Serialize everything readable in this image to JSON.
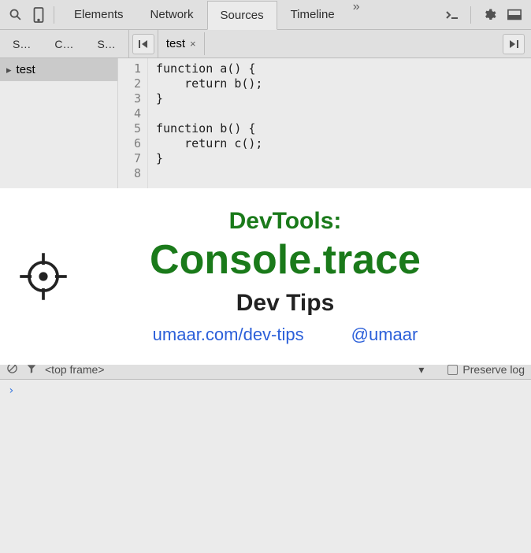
{
  "toolbar": {
    "tabs": [
      "Elements",
      "Network",
      "Sources",
      "Timeline"
    ],
    "active_tab_index": 2,
    "overflow": "»"
  },
  "subtoolbar": {
    "minitabs": [
      "S…",
      "C…",
      "S…"
    ],
    "file_tab": "test",
    "close": "×"
  },
  "sidebar": {
    "tree_item": "test",
    "expand": "▸"
  },
  "editor": {
    "lines": [
      "function a() {",
      "    return b();",
      "}",
      "",
      "function b() {",
      "    return c();",
      "}",
      ""
    ]
  },
  "consolebar": {
    "frame": "<top frame>",
    "dropdown": "▾",
    "preserve": "Preserve log"
  },
  "console": {
    "prompt": "›"
  },
  "banner": {
    "line1": "DevTools:",
    "line2": "Console.trace",
    "line3": "Dev Tips",
    "link1": "umaar.com/dev-tips",
    "link2": "@umaar"
  }
}
